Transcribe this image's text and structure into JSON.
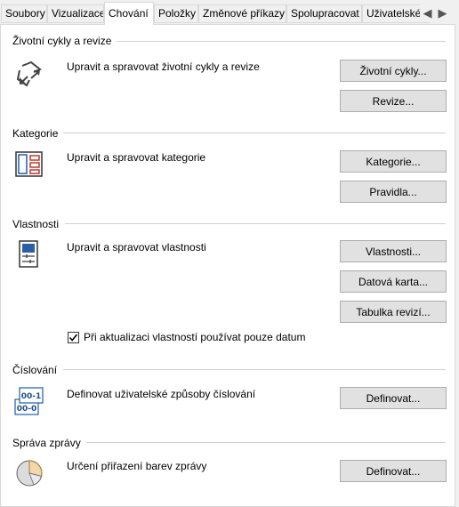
{
  "tabs": [
    {
      "label": "Soubory"
    },
    {
      "label": "Vizualizace"
    },
    {
      "label": "Chování"
    },
    {
      "label": "Položky"
    },
    {
      "label": "Změnové příkazy"
    },
    {
      "label": "Spolupracovat"
    },
    {
      "label": "Uživatelské ol"
    }
  ],
  "active_tab": "Chování",
  "scroll": {
    "left": "◀",
    "right": "▶"
  },
  "sections": {
    "lifecycle": {
      "title": "Životní cykly a revize",
      "description": "Upravit a spravovat životní cykly a revize",
      "buttons": [
        "Životní cykly...",
        "Revize..."
      ],
      "icon": "lifecycle-icon"
    },
    "category": {
      "title": "Kategorie",
      "description": "Upravit a spravovat kategorie",
      "buttons": [
        "Kategorie...",
        "Pravidla..."
      ],
      "icon": "category-icon"
    },
    "properties": {
      "title": "Vlastnosti",
      "description": "Upravit a spravovat vlastnosti",
      "buttons": [
        "Vlastnosti...",
        "Datová karta...",
        "Tabulka revizí..."
      ],
      "icon": "properties-icon",
      "checkbox_label": "Při aktualizaci vlastností používat pouze datum",
      "checkbox_checked": true
    },
    "numbering": {
      "title": "Číslování",
      "description": "Definovat uživatelské způsoby číslování",
      "buttons": [
        "Definovat..."
      ],
      "icon": "numbering-icon",
      "icon_text": [
        "00-1",
        "00-0"
      ]
    },
    "report": {
      "title": "Správa zprávy",
      "description": "Určení přiřazení barev zprávy",
      "buttons": [
        "Definovat..."
      ],
      "icon": "pie-chart-icon"
    }
  }
}
